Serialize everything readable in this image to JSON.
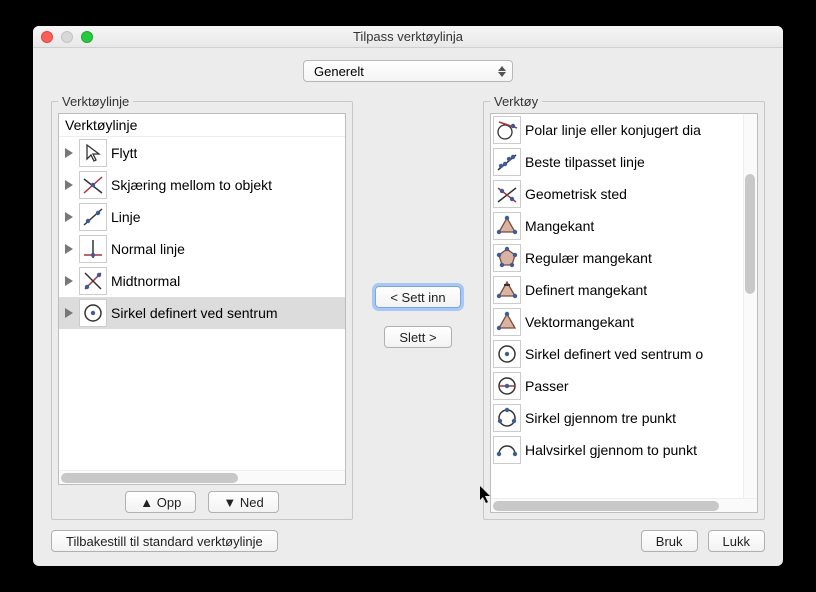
{
  "window": {
    "title": "Tilpass verktøylinja"
  },
  "category": {
    "selected": "Generelt"
  },
  "leftPanel": {
    "legend": "Verktøylinje",
    "header": "Verktøylinje",
    "items": [
      {
        "label": "Flytt",
        "icon": "pointer",
        "selected": false
      },
      {
        "label": "Skjæring mellom to objekt",
        "icon": "intersect",
        "selected": false
      },
      {
        "label": "Linje",
        "icon": "line",
        "selected": false
      },
      {
        "label": "Normal linje",
        "icon": "perp",
        "selected": false
      },
      {
        "label": "Midtnormal",
        "icon": "midperp",
        "selected": false
      },
      {
        "label": "Sirkel definert ved sentrum",
        "icon": "circle-center",
        "selected": true
      }
    ],
    "upLabel": "▲ Opp",
    "downLabel": "▼ Ned"
  },
  "middle": {
    "insert": "< Sett inn",
    "delete": "Slett >"
  },
  "rightPanel": {
    "legend": "Verktøy",
    "items": [
      {
        "label": "Polar linje eller konjugert dia",
        "icon": "polar"
      },
      {
        "label": "Beste tilpasset linje",
        "icon": "bestfit"
      },
      {
        "label": "Geometrisk sted",
        "icon": "locus"
      },
      {
        "label": "Mangekant",
        "icon": "polygon"
      },
      {
        "label": "Regulær mangekant",
        "icon": "regpoly"
      },
      {
        "label": "Definert mangekant",
        "icon": "rigidpoly"
      },
      {
        "label": "Vektormangekant",
        "icon": "vecpoly"
      },
      {
        "label": "Sirkel definert ved sentrum o",
        "icon": "circle-center"
      },
      {
        "label": "Passer",
        "icon": "compass"
      },
      {
        "label": "Sirkel gjennom tre punkt",
        "icon": "circle3pt"
      },
      {
        "label": "Halvsirkel gjennom to punkt",
        "icon": "semicircle"
      }
    ]
  },
  "bottom": {
    "reset": "Tilbakestill til standard verktøylinje",
    "apply": "Bruk",
    "close": "Lukk"
  }
}
